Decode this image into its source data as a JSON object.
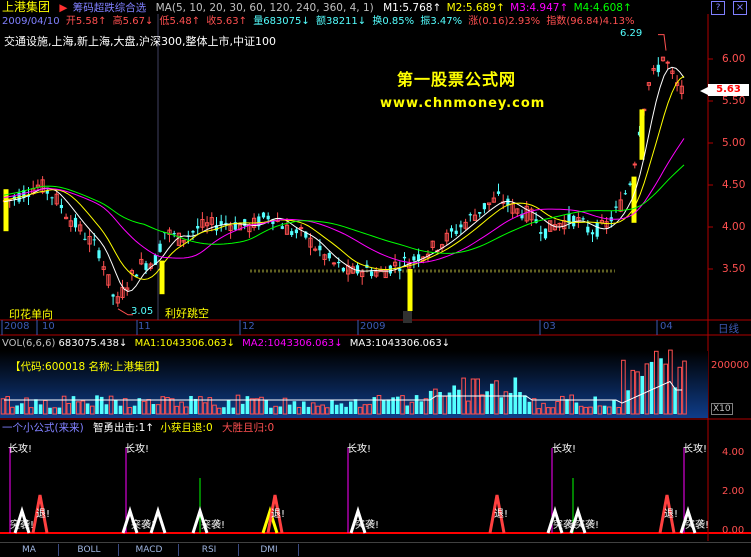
{
  "header": {
    "stock_name": "上港集团",
    "indicator_name": "筹码超跌综合选",
    "ma_params": "MA(5, 10, 20, 30, 60, 120, 240, 360, 4, 1)",
    "m1": "M1:5.768",
    "m2": "M2:5.689",
    "m3": "M3:4.947",
    "m4": "M4:4.608",
    "dir_m1": "↑",
    "dir_m2": "↑",
    "dir_m3": "↑",
    "dir_m4": "↑",
    "help_icon": "?",
    "close_icon": "×"
  },
  "quote": {
    "date": "2009/04/10",
    "open": "开5.58",
    "open_dir": "↑",
    "high": "高5.67",
    "high_dir": "↓",
    "low": "低5.48",
    "low_dir": "↑",
    "close": "收5.63",
    "close_dir": "↑",
    "volume": "量683075",
    "volume_dir": "↓",
    "amount": "额38211",
    "amount_dir": "↓",
    "turnover": "换0.85%",
    "amplitude": "振3.47%",
    "change": "涨(0.16)2.93%",
    "index": "指数(96.84)4.13%"
  },
  "concepts": "交通设施,上海,新上海,大盘,沪深300,整体上市,中证100",
  "watermark": {
    "title": "第一股票公式网",
    "url": "www.chnmoney.com"
  },
  "annotations": {
    "high_label": "6.29",
    "low_label": "3.05",
    "current_price": "5.63",
    "left_note": "印花单向",
    "right_note": "利好跳空"
  },
  "price_axis": [
    "6.00",
    "5.50",
    "5.00",
    "4.50",
    "4.00",
    "3.50"
  ],
  "time_axis": [
    "2008",
    "10",
    "11",
    "12",
    "2009",
    "03",
    "04"
  ],
  "time_unit": "日线",
  "volume_panel": {
    "header_vol": "VOL(6,6,6)",
    "header_val": "683075.438",
    "header_dir": "↓",
    "ma1": "MA1:1043306.063",
    "ma1_dir": "↓",
    "ma2": "MA2:1043306.063",
    "ma2_dir": "↓",
    "ma3": "MA3:1043306.063",
    "ma3_dir": "↓",
    "code_label": "【代码:600018 名称:上港集团】",
    "axis_label": "200000",
    "multiplier": "X10"
  },
  "signal_panel": {
    "title": "一个小公式(来来)",
    "signal1": "智勇出击:1",
    "signal1_dir": "↑",
    "signal2": "小获且退:0",
    "signal3": "大胜且归:0",
    "axis": [
      "4.00",
      "2.00",
      "0.00"
    ],
    "attack_label": "长攻!",
    "raid_label": "突袭!",
    "retreat_label": "退!"
  },
  "bottom_tabs": [
    "MA",
    "BOLL",
    "MACD",
    "RSI",
    "DMI"
  ],
  "colors": {
    "up": "#ff5050",
    "down": "#54ffff",
    "yellow": "#ffff00",
    "magenta": "#ff00ff",
    "green": "#00ff00",
    "white": "#ffffff",
    "grid": "#b00000",
    "axis_blue": "#3c5ab4"
  },
  "chart_data": [
    {
      "type": "candlestick",
      "title": "上港集团",
      "ylim": [
        3.0,
        6.35
      ],
      "ma_lines": [
        "M1",
        "M2",
        "M3",
        "M4"
      ],
      "x_ticks": [
        "2008",
        "10",
        "11",
        "12",
        "2009",
        "03",
        "04"
      ],
      "y_ticks": [
        6.0,
        5.5,
        5.0,
        4.5,
        4.0,
        3.5
      ],
      "markers": {
        "high": 6.29,
        "low": 3.05,
        "last": 5.63
      }
    },
    {
      "type": "bar",
      "title": "VOL(6,6,6)",
      "y_ticks": [
        200000
      ]
    },
    {
      "type": "bar",
      "title": "一个小公式(来来)",
      "y_ticks": [
        4.0,
        2.0,
        0.0
      ]
    }
  ]
}
